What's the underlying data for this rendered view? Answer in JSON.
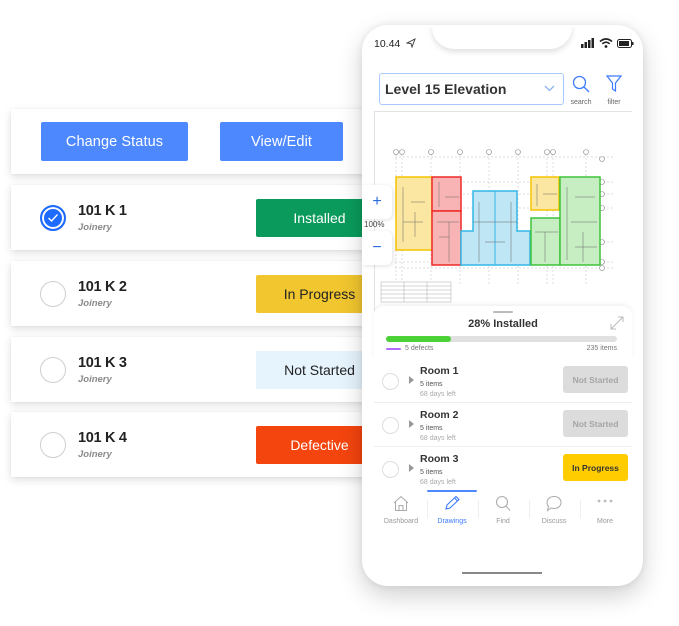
{
  "left_panel": {
    "actions": {
      "change_status_label": "Change Status",
      "view_edit_label": "View/Edit"
    },
    "items": [
      {
        "name": "101 K 1",
        "category": "Joinery",
        "checked": true,
        "status": "Installed",
        "status_bg": "#0a9b5c",
        "status_fg": "#ffffff"
      },
      {
        "name": "101 K 2",
        "category": "Joinery",
        "checked": false,
        "status": "In Progress",
        "status_bg": "#f1c62f",
        "status_fg": "#222222"
      },
      {
        "name": "101 K 3",
        "category": "Joinery",
        "checked": false,
        "status": "Not Started",
        "status_bg": "#e6f4fd",
        "status_fg": "#222222"
      },
      {
        "name": "101 K 4",
        "category": "Joinery",
        "checked": false,
        "status": "Defective",
        "status_bg": "#f4450f",
        "status_fg": "#ffffff"
      }
    ]
  },
  "phone": {
    "status_bar": {
      "time": "10.44"
    },
    "header": {
      "level_select": "Level 15 Elevation",
      "search_label": "search",
      "filter_label": "filter"
    },
    "drawing": {
      "zoom_in": "+",
      "zoom_level": "100%",
      "zoom_out": "−",
      "zone_colors": {
        "yellow": "#f3c300",
        "red": "#ee2a2a",
        "blue": "#33b7e6",
        "green": "#3fc23a"
      }
    },
    "summary": {
      "title": "28% Installed",
      "progress_percent": 28,
      "defects_label": "5 defects",
      "items_label": "235 items",
      "progress_color": "#4cd137",
      "defect_color": "#b26bff"
    },
    "rooms": [
      {
        "name": "Room 1",
        "items": "5 items",
        "days_left": "68 days left",
        "status": "Not Started",
        "status_bg": "#dcdcdc",
        "status_fg": "#a5a5a5"
      },
      {
        "name": "Room 2",
        "items": "5 items",
        "days_left": "68 days left",
        "status": "Not Started",
        "status_bg": "#dcdcdc",
        "status_fg": "#a5a5a5"
      },
      {
        "name": "Room 3",
        "items": "5 items",
        "days_left": "68 days left",
        "status": "In Progress",
        "status_bg": "#ffcc00",
        "status_fg": "#333333"
      }
    ],
    "tabbar": {
      "tabs": [
        {
          "label": "Dashboard",
          "icon": "home-icon",
          "active": false
        },
        {
          "label": "Drawings",
          "icon": "pencil-icon",
          "active": true
        },
        {
          "label": "Find",
          "icon": "search-icon",
          "active": false
        },
        {
          "label": "Discuss",
          "icon": "chat-bubble-icon",
          "active": false
        },
        {
          "label": "More",
          "icon": "more-dots-icon",
          "active": false
        }
      ]
    }
  }
}
